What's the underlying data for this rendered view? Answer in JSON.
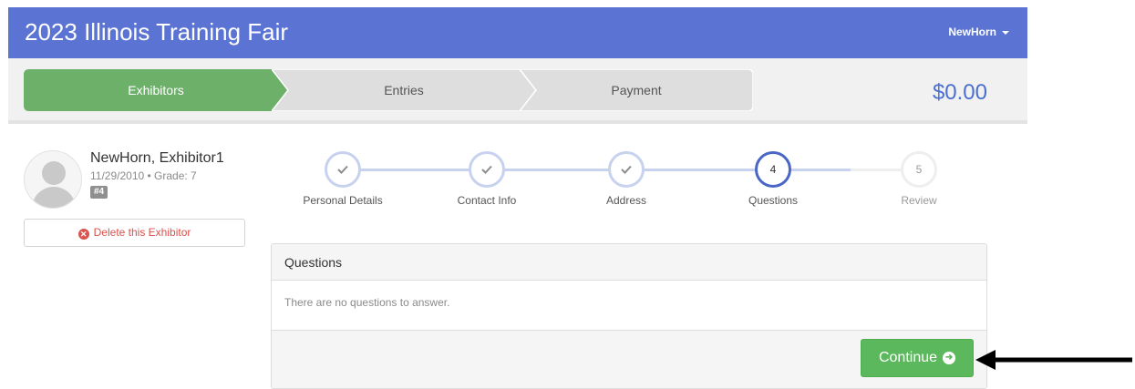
{
  "navbar": {
    "title": "2023 Illinois Training Fair",
    "user": "NewHorn"
  },
  "progress": {
    "crumbs": [
      {
        "label": "Exhibitors",
        "state": "active"
      },
      {
        "label": "Entries",
        "state": "inactive"
      },
      {
        "label": "Payment",
        "state": "inactive"
      }
    ],
    "total": "$0.00"
  },
  "exhibitor": {
    "name": "NewHorn, Exhibitor1",
    "meta": "11/29/2010 • Grade: 7",
    "tag": "#4",
    "delete_label": "Delete this Exhibitor"
  },
  "steps": [
    {
      "label": "Personal Details",
      "state": "done",
      "number": ""
    },
    {
      "label": "Contact Info",
      "state": "done",
      "number": ""
    },
    {
      "label": "Address",
      "state": "done",
      "number": ""
    },
    {
      "label": "Questions",
      "state": "active",
      "number": "4"
    },
    {
      "label": "Review",
      "state": "todo",
      "number": "5"
    }
  ],
  "panel": {
    "heading": "Questions",
    "body": "There are no questions to answer.",
    "continue_label": "Continue"
  },
  "colors": {
    "navbar": "#5b73d2",
    "active_crumb": "#6db06a",
    "accent": "#4a66c7",
    "success": "#5cb85c",
    "danger": "#d9534f"
  }
}
